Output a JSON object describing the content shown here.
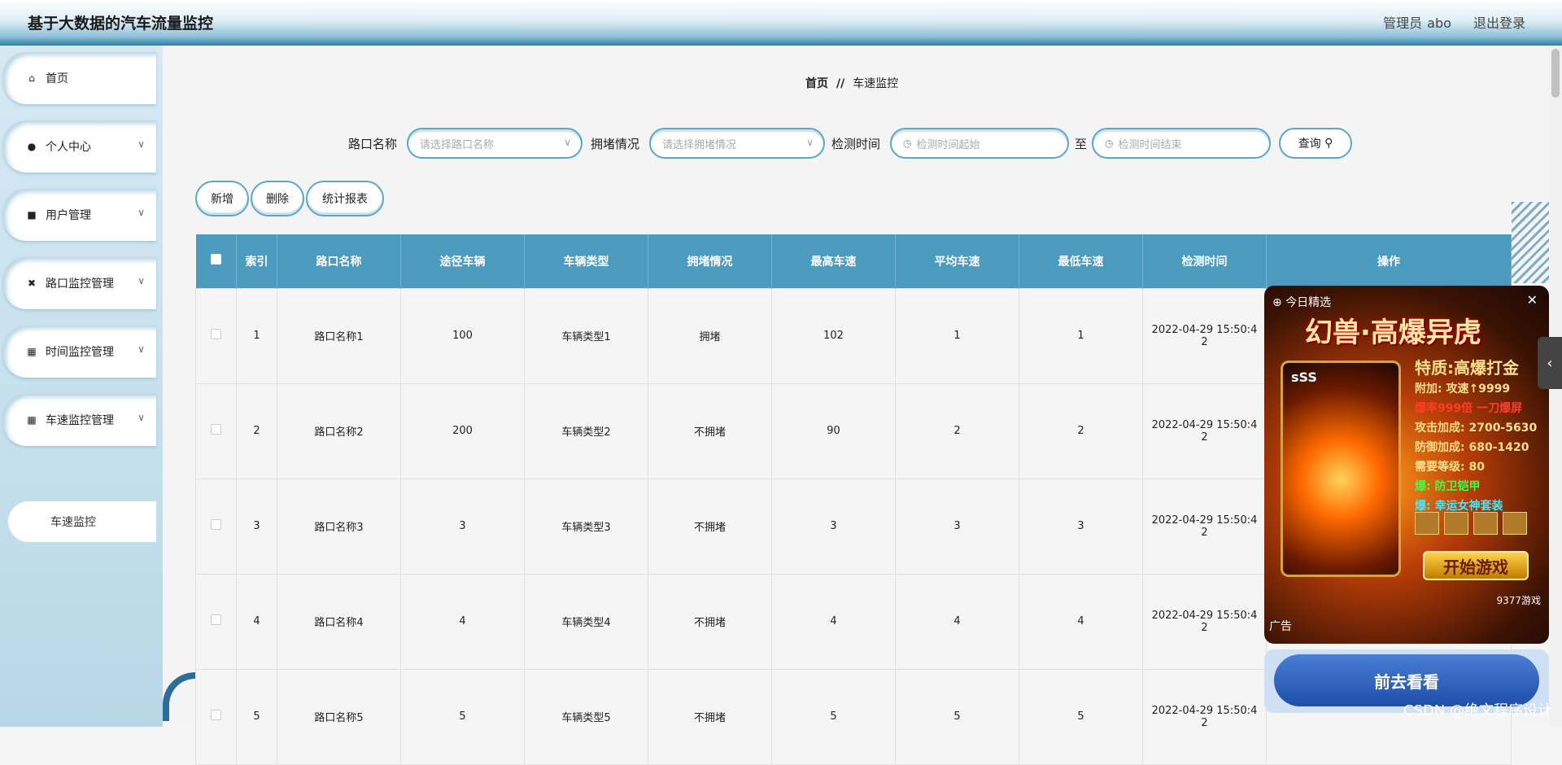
{
  "app": {
    "title": "基于大数据的汽车流量监控"
  },
  "header": {
    "role": "管理员",
    "username": "abo",
    "logout": "退出登录"
  },
  "sidebar": {
    "items": [
      {
        "label": "首页",
        "icon": "home-icon",
        "expandable": false
      },
      {
        "label": "个人中心",
        "icon": "person-icon",
        "expandable": true
      },
      {
        "label": "用户管理",
        "icon": "users-icon",
        "expandable": true
      },
      {
        "label": "路口监控管理",
        "icon": "crossroad-icon",
        "expandable": true
      },
      {
        "label": "时间监控管理",
        "icon": "grid-icon",
        "expandable": true
      },
      {
        "label": "车速监控管理",
        "icon": "grid-icon",
        "expandable": true
      }
    ],
    "submenu": {
      "label": "车速监控"
    }
  },
  "breadcrumb": {
    "home": "首页",
    "separator": "//",
    "current": "车速监控"
  },
  "filters": {
    "crossing": {
      "label": "路口名称",
      "placeholder": "请选择路口名称"
    },
    "congestion": {
      "label": "拥堵情况",
      "placeholder": "请选择拥堵情况"
    },
    "time": {
      "label": "检测时间",
      "start_placeholder": "检测时间起始",
      "to": "至",
      "end_placeholder": "检测时间结束"
    },
    "search": "查询"
  },
  "actions": {
    "add": "新增",
    "delete": "删除",
    "report": "统计报表"
  },
  "table": {
    "headers": [
      "索引",
      "路口名称",
      "途径车辆",
      "车辆类型",
      "拥堵情况",
      "最高车速",
      "平均车速",
      "最低车速",
      "检测时间",
      "操作"
    ],
    "rows": [
      {
        "index": "1",
        "name": "路口名称1",
        "vehicles": "100",
        "type": "车辆类型1",
        "congestion": "拥堵",
        "max": "102",
        "avg": "1",
        "min": "1",
        "time_line1": "2022-04-29 15:50:4",
        "time_line2": "2"
      },
      {
        "index": "2",
        "name": "路口名称2",
        "vehicles": "200",
        "type": "车辆类型2",
        "congestion": "不拥堵",
        "max": "90",
        "avg": "2",
        "min": "2",
        "time_line1": "2022-04-29 15:50:4",
        "time_line2": "2"
      },
      {
        "index": "3",
        "name": "路口名称3",
        "vehicles": "3",
        "type": "车辆类型3",
        "congestion": "不拥堵",
        "max": "3",
        "avg": "3",
        "min": "3",
        "time_line1": "2022-04-29 15:50:4",
        "time_line2": "2"
      },
      {
        "index": "4",
        "name": "路口名称4",
        "vehicles": "4",
        "type": "车辆类型4",
        "congestion": "不拥堵",
        "max": "4",
        "avg": "4",
        "min": "4",
        "time_line1": "2022-04-29 15:50:4",
        "time_line2": "2"
      },
      {
        "index": "5",
        "name": "路口名称5",
        "vehicles": "5",
        "type": "车辆类型5",
        "congestion": "不拥堵",
        "max": "5",
        "avg": "5",
        "min": "5",
        "time_line1": "2022-04-29 15:50:4",
        "time_line2": "2"
      }
    ]
  },
  "ad": {
    "top": "今日精选",
    "headline": "幻兽·高爆异虎",
    "tier": "sSS",
    "feature": "特质:高爆打金",
    "lines": [
      "附加: 攻速↑9999",
      "爆率999倍 一刀爆屏",
      "攻击加成: 2700-5630",
      "防御加成: 680-1420",
      "需要等级: 80",
      "爆: 防卫铠甲",
      "爆: 幸运女神套装"
    ],
    "play": "开始游戏",
    "brand": "9377游戏",
    "label": "广告",
    "go": "前去看看"
  },
  "watermark": "CSDN @绝文程序设计",
  "colors": {
    "accent": "#4b9bbf",
    "header_dark": "#2a7fa8",
    "sidebar_bg": "#c4dfec"
  }
}
